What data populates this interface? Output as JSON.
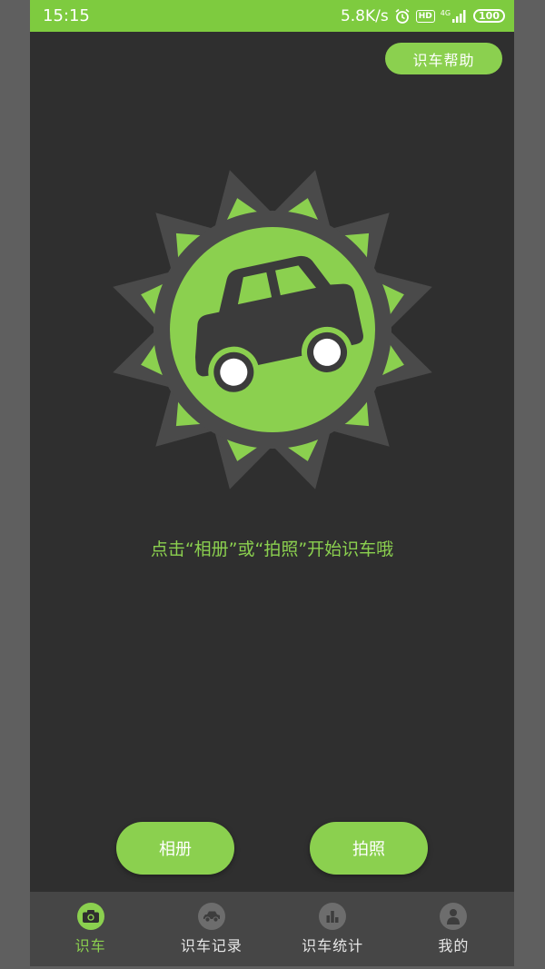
{
  "status_bar": {
    "time": "15:15",
    "net_speed": "5.8K/s",
    "hd_badge": "HD",
    "signal_label": "4G",
    "battery": "100"
  },
  "header": {
    "help_label": "识车帮助"
  },
  "main": {
    "logo_icon": "car-badge-icon",
    "hint": "点击“相册”或“拍照”开始识车哦",
    "album_label": "相册",
    "camera_label": "拍照"
  },
  "bottom_nav": {
    "items": [
      {
        "label": "识车",
        "icon": "camera-icon",
        "active": true
      },
      {
        "label": "识车记录",
        "icon": "car-icon",
        "active": false
      },
      {
        "label": "识车统计",
        "icon": "bar-chart-icon",
        "active": false
      },
      {
        "label": "我的",
        "icon": "person-icon",
        "active": false
      }
    ]
  },
  "colors": {
    "accent": "#8bd04f",
    "status_bar": "#7ecb3f",
    "background": "#2f2f2f",
    "nav_background": "#464646"
  }
}
